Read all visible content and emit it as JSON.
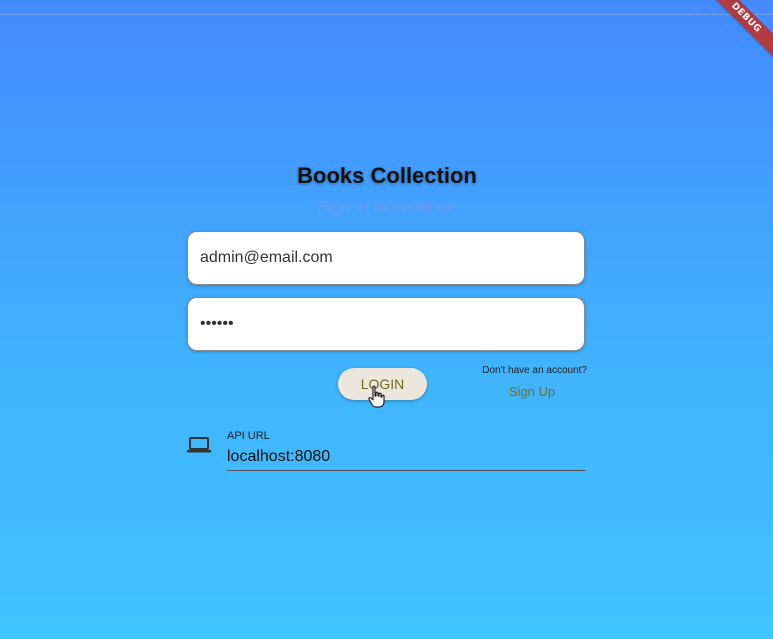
{
  "app": {
    "debug_banner": "DEBUG"
  },
  "header": {
    "title": "Books Collection",
    "subtitle": "Sign in to continue"
  },
  "login_form": {
    "email_value": "admin@email.com",
    "password_value": "••••••",
    "login_label": "LOGIN"
  },
  "signup": {
    "prompt": "Don't have an account?",
    "link_label": "Sign Up"
  },
  "api": {
    "icon": "laptop-icon",
    "label": "API URL",
    "value": "localhost:8080"
  },
  "colors": {
    "background_top": "#448aff",
    "background_bottom": "#40c4ff",
    "button_bg": "#ebe7dc",
    "button_text": "#6b6b1d",
    "link": "#7a6a1a"
  }
}
